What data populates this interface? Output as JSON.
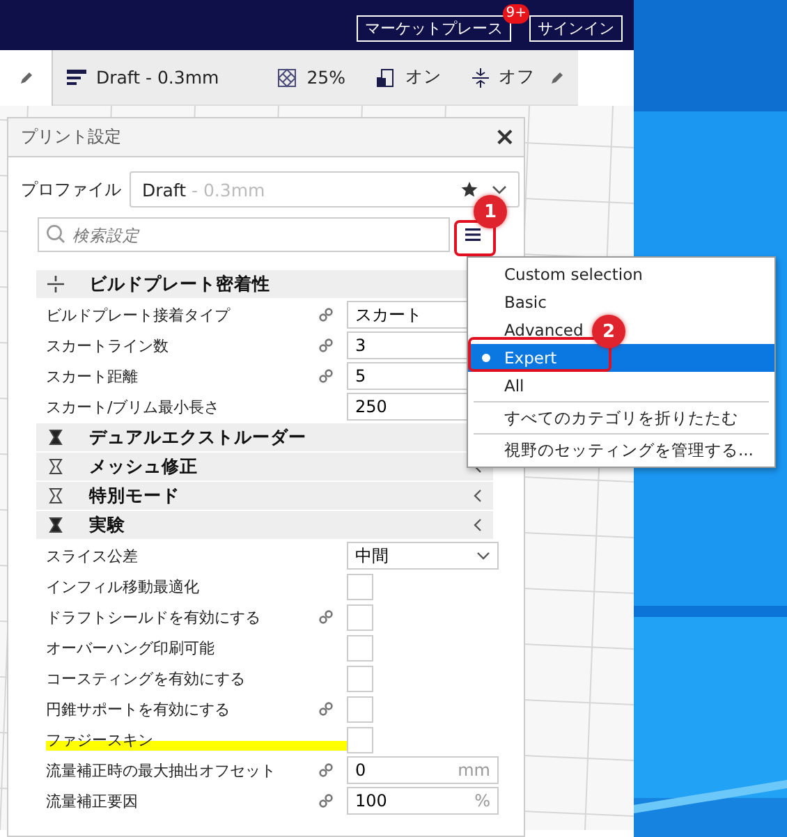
{
  "header": {
    "marketplace": "マーケットプレース",
    "badge": "9+",
    "signin": "サインイン"
  },
  "toolbar": {
    "profile": "Draft - 0.3mm",
    "infill": "25%",
    "support": "オン",
    "adhesion": "オフ"
  },
  "panel": {
    "title": "プリント設定",
    "close": "×",
    "profile_label": "プロファイル",
    "profile_name": "Draft",
    "profile_detail": " - 0.3mm",
    "search_placeholder": "検索設定",
    "sections": [
      {
        "kind": "category",
        "label": "ビルドプレート密着性"
      },
      {
        "kind": "select",
        "label": "ビルドプレート接着タイプ",
        "linked": true,
        "value": "スカート"
      },
      {
        "kind": "number",
        "label": "スカートライン数",
        "linked": true,
        "value": "3"
      },
      {
        "kind": "number",
        "label": "スカート距離",
        "linked": true,
        "value": "5"
      },
      {
        "kind": "number",
        "label": "スカート/ブリム最小長さ",
        "linked": false,
        "value": "250"
      },
      {
        "kind": "category",
        "label": "デュアルエクストルーダー"
      },
      {
        "kind": "category",
        "label": "メッシュ修正",
        "chevron": true
      },
      {
        "kind": "category",
        "label": "特別モード",
        "chevron": true
      },
      {
        "kind": "category",
        "label": "実験",
        "chevron": true
      },
      {
        "kind": "select",
        "label": "スライス公差",
        "linked": false,
        "value": "中間",
        "chevron": true
      },
      {
        "kind": "checkbox",
        "label": "インフィル移動最適化",
        "linked": false,
        "checked": false,
        "highlighted": false
      },
      {
        "kind": "checkbox",
        "label": "ドラフトシールドを有効にする",
        "linked": true,
        "checked": false,
        "highlighted": false
      },
      {
        "kind": "checkbox",
        "label": "オーバーハング印刷可能",
        "linked": false,
        "checked": false,
        "highlighted": false
      },
      {
        "kind": "checkbox",
        "label": "コースティングを有効にする",
        "linked": false,
        "checked": false,
        "highlighted": false
      },
      {
        "kind": "checkbox",
        "label": "円錐サポートを有効にする",
        "linked": true,
        "checked": false,
        "highlighted": false
      },
      {
        "kind": "checkbox",
        "label": "ファジースキン",
        "linked": false,
        "checked": false,
        "highlighted": true
      },
      {
        "kind": "number",
        "label": "流量補正時の最大抽出オフセット",
        "linked": true,
        "value": "0",
        "unit": "mm"
      },
      {
        "kind": "number",
        "label": "流量補正要因",
        "linked": true,
        "value": "100",
        "unit": "%"
      }
    ]
  },
  "menu": [
    {
      "kind": "option",
      "label": "Custom selection",
      "selected": false
    },
    {
      "kind": "option",
      "label": "Basic",
      "selected": false
    },
    {
      "kind": "option",
      "label": "Advanced",
      "selected": false
    },
    {
      "kind": "option",
      "label": "Expert",
      "selected": true
    },
    {
      "kind": "option",
      "label": "All",
      "selected": false
    },
    {
      "kind": "action",
      "label": "すべてのカテゴリを折りたたむ"
    },
    {
      "kind": "action",
      "label": "視野のセッティングを管理する..."
    }
  ],
  "annotations": [
    {
      "number": "1"
    },
    {
      "number": "2"
    }
  ]
}
